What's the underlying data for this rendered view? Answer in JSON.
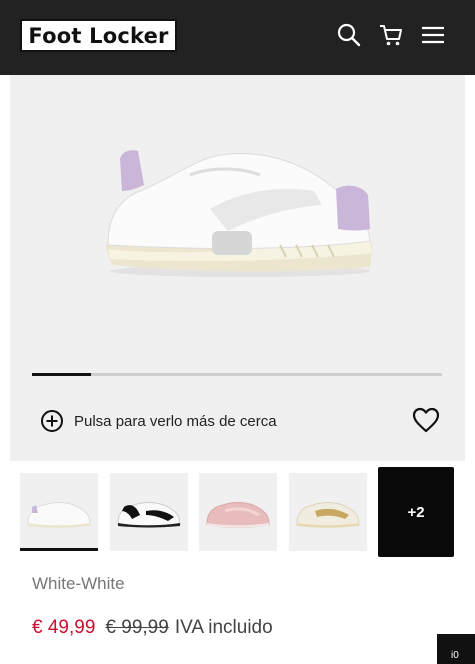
{
  "header": {
    "logo_text": "Foot Locker",
    "icons": [
      "search-icon",
      "cart-icon",
      "menu-icon"
    ]
  },
  "gallery": {
    "progress": 0.145,
    "zoom_label": "Pulsa para verlo más de cerca",
    "zoom_icon": "plus-circle-icon",
    "favorite_icon": "heart-icon"
  },
  "thumbnails": {
    "items": [
      {
        "variant": "white-lilac",
        "active": true
      },
      {
        "variant": "white-black",
        "active": false
      },
      {
        "variant": "pink",
        "active": false
      },
      {
        "variant": "beige-gold",
        "active": false
      }
    ],
    "more_label": "+2"
  },
  "product": {
    "colorway": "White-White",
    "price_sale": "€ 49,99",
    "price_original": "€ 99,99",
    "tax_note": "IVA incluido"
  },
  "corner_badge": "i0",
  "colors": {
    "header_bg": "#222222",
    "sale_price": "#c8102e",
    "gallery_bg": "#f0f0f0"
  }
}
